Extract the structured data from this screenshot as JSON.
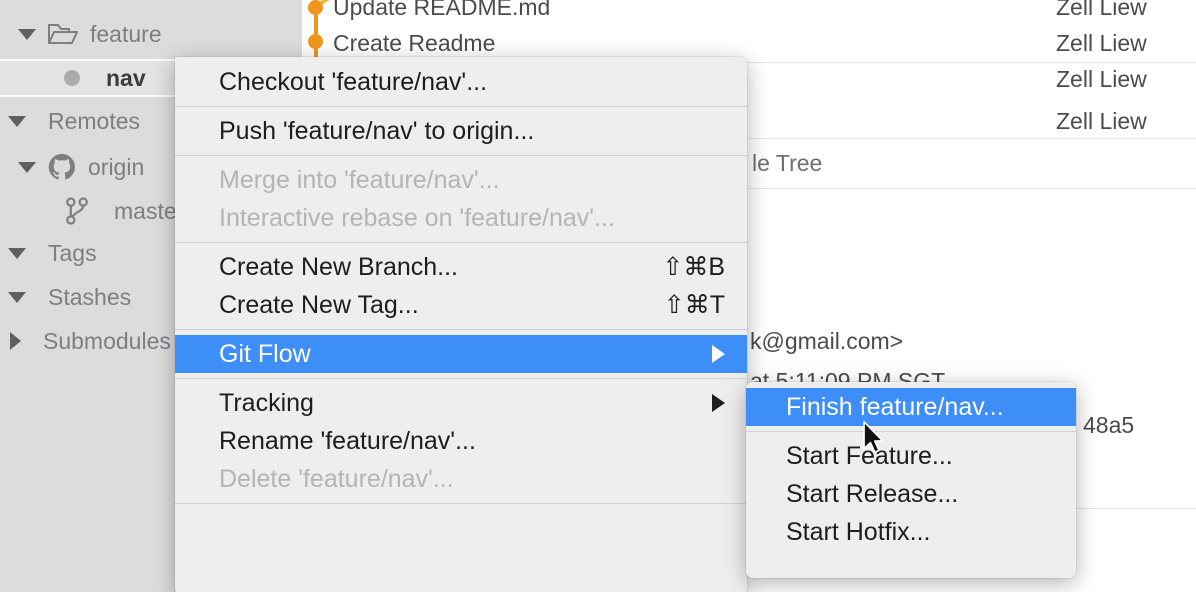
{
  "sidebar": {
    "rows": [
      {
        "label": "feature",
        "icon": "folder-open-icon",
        "twisty": "down",
        "indent": 1,
        "kind": "folder"
      },
      {
        "label": "nav",
        "icon": "dot-icon",
        "twisty": "none",
        "indent": 2,
        "kind": "branch-selected"
      },
      {
        "label": "Remotes",
        "icon": "none",
        "twisty": "down",
        "indent": 0,
        "kind": "group"
      },
      {
        "label": "origin",
        "icon": "github-icon",
        "twisty": "down",
        "indent": 1,
        "kind": "remote"
      },
      {
        "label": "master",
        "icon": "branch-icon",
        "twisty": "none",
        "indent": 2,
        "kind": "branch"
      },
      {
        "label": "Tags",
        "icon": "none",
        "twisty": "down",
        "indent": 0,
        "kind": "group"
      },
      {
        "label": "Stashes",
        "icon": "none",
        "twisty": "down",
        "indent": 0,
        "kind": "group"
      },
      {
        "label": "Submodules",
        "icon": "none",
        "twisty": "right",
        "indent": 0,
        "kind": "group"
      }
    ]
  },
  "log": {
    "commits": [
      {
        "message": "Update README.md",
        "author": "Zell Liew"
      },
      {
        "message": "Create Readme",
        "author": "Zell Liew"
      }
    ],
    "authors_extra": [
      "Zell Liew",
      "Zell Liew"
    ],
    "detail_tab": "le Tree",
    "detail_email": "k@gmail.com>",
    "detail_date": "at 5:11:09 PM SGT",
    "detail_hash": "48a5"
  },
  "context_menu": {
    "items": [
      {
        "label": "Checkout 'feature/nav'...",
        "shortcut": "",
        "state": "normal",
        "submenu": false
      },
      {
        "type": "separator"
      },
      {
        "label": "Push 'feature/nav' to origin...",
        "shortcut": "",
        "state": "normal",
        "submenu": false
      },
      {
        "type": "separator"
      },
      {
        "label": "Merge into 'feature/nav'...",
        "shortcut": "",
        "state": "disabled",
        "submenu": false
      },
      {
        "label": "Interactive rebase on 'feature/nav'...",
        "shortcut": "",
        "state": "disabled",
        "submenu": false
      },
      {
        "type": "separator"
      },
      {
        "label": "Create New Branch...",
        "shortcut": "⇧⌘B",
        "state": "normal",
        "submenu": false
      },
      {
        "label": "Create New Tag...",
        "shortcut": "⇧⌘T",
        "state": "normal",
        "submenu": false
      },
      {
        "type": "separator"
      },
      {
        "label": "Git Flow",
        "shortcut": "",
        "state": "highlight",
        "submenu": true
      },
      {
        "type": "separator"
      },
      {
        "label": "Tracking",
        "shortcut": "",
        "state": "normal",
        "submenu": true
      },
      {
        "label": "Rename 'feature/nav'...",
        "shortcut": "",
        "state": "normal",
        "submenu": false
      },
      {
        "label": "Delete 'feature/nav'...",
        "shortcut": "",
        "state": "disabled",
        "submenu": false
      },
      {
        "type": "separator"
      }
    ]
  },
  "submenu": {
    "items": [
      {
        "label": "Finish feature/nav...",
        "state": "highlight"
      },
      {
        "type": "separator"
      },
      {
        "label": "Start Feature...",
        "state": "normal"
      },
      {
        "label": "Start Release...",
        "state": "normal"
      },
      {
        "label": "Start Hotfix...",
        "state": "normal"
      }
    ]
  },
  "colors": {
    "highlight": "#3e8ef7",
    "menu_bg": "#eeeeee",
    "sidebar_bg": "#dcdcdc",
    "graph_orange": "#f0951e",
    "selected_row": "#e3e3e3"
  }
}
